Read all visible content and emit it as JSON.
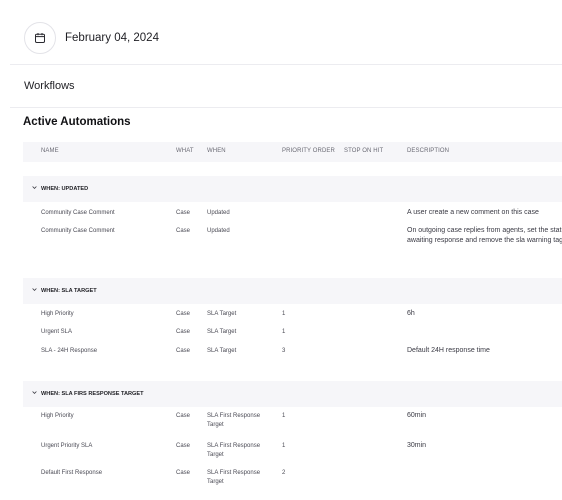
{
  "header": {
    "date": "February 04, 2024",
    "calendar_icon": "calendar-icon"
  },
  "page": {
    "title": "Workflows",
    "section_title": "Active Automations"
  },
  "table": {
    "columns": [
      "NAME",
      "WHAT",
      "WHEN",
      "PRIORITY ORDER",
      "STOP ON HIT",
      "DESCRIPTION"
    ],
    "groups": [
      {
        "label": "WHEN: UPDATED",
        "rows": [
          {
            "name": "Community Case Comment",
            "what": "Case",
            "when": "Updated",
            "priority": "",
            "stop": "",
            "description": "A user create a new comment on this case"
          },
          {
            "name": "Community Case Comment",
            "what": "Case",
            "when": "Updated",
            "priority": "",
            "stop": "",
            "description": "On outgoing case replies from agents, set the status to awaiting response and remove the sla warning tag."
          }
        ]
      },
      {
        "label": "WHEN: SLA TARGET",
        "rows": [
          {
            "name": "High Priority",
            "what": "Case",
            "when": "SLA Target",
            "priority": "1",
            "stop": "",
            "description": "6h"
          },
          {
            "name": "Urgent SLA",
            "what": "Case",
            "when": "SLA Target",
            "priority": "1",
            "stop": "",
            "description": ""
          },
          {
            "name": "SLA - 24H Response",
            "what": "Case",
            "when": "SLA Target",
            "priority": "3",
            "stop": "",
            "description": "Default 24H response time"
          }
        ]
      },
      {
        "label": "WHEN: SLA FIRS RESPONSE TARGET",
        "rows": [
          {
            "name": "High Priority",
            "what": "Case",
            "when": "SLA First Response Target",
            "priority": "1",
            "stop": "",
            "description": "60min"
          },
          {
            "name": "Urgent Priority SLA",
            "what": "Case",
            "when": "SLA First Response Target",
            "priority": "1",
            "stop": "",
            "description": "30min"
          },
          {
            "name": "Default First Response",
            "what": "Case",
            "when": "SLA First Response Target",
            "priority": "2",
            "stop": "",
            "description": ""
          }
        ]
      }
    ]
  }
}
